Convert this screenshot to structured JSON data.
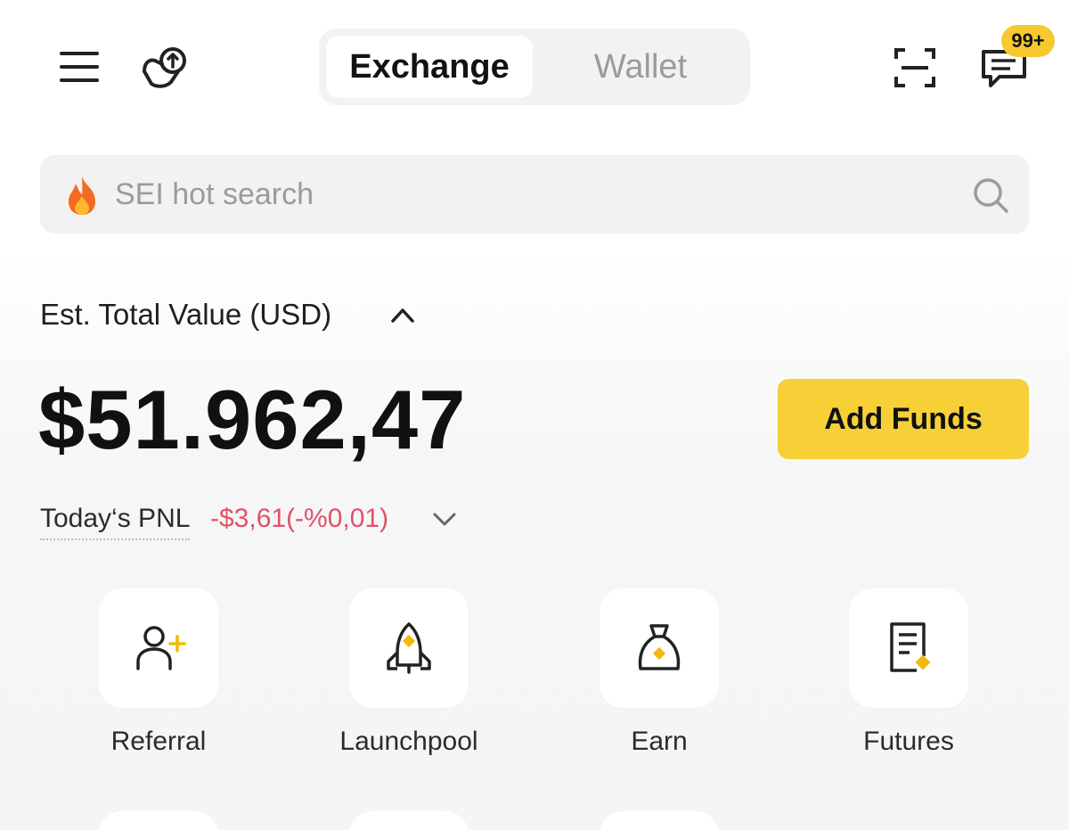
{
  "header": {
    "tabs": [
      {
        "label": "Exchange",
        "active": true
      },
      {
        "label": "Wallet",
        "active": false
      }
    ],
    "notification_badge": "99+",
    "icons": [
      "menu-icon",
      "buddy-icon",
      "scan-icon",
      "chat-icon"
    ]
  },
  "search": {
    "placeholder": "SEI hot search",
    "icons": [
      "fire-icon",
      "search-icon"
    ]
  },
  "portfolio": {
    "label": "Est. Total Value (USD)",
    "total_value": "$51.962,47",
    "add_funds_label": "Add Funds",
    "pnl_label": "Today‘s PNL",
    "pnl_value": "-$3,61(-%0,01)"
  },
  "shortcuts": [
    {
      "label": "Referral",
      "icon": "referral-icon"
    },
    {
      "label": "Launchpool",
      "icon": "rocket-icon"
    },
    {
      "label": "Earn",
      "icon": "money-bag-icon"
    },
    {
      "label": "Futures",
      "icon": "document-icon"
    }
  ],
  "colors": {
    "accent": "#f7d038",
    "badge": "#f7c931",
    "loss": "#e0526a",
    "muted": "#9b9b9b",
    "surface": "#f2f2f2"
  }
}
